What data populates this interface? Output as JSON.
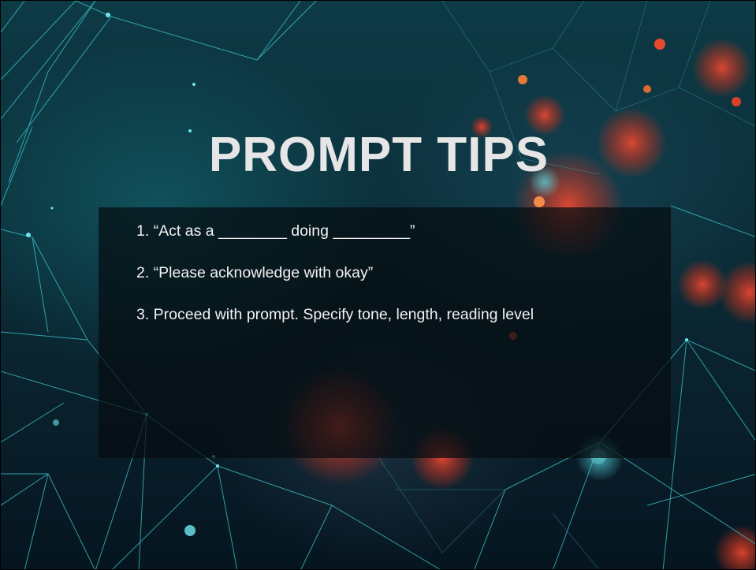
{
  "slide": {
    "title": "PROMPT TIPS",
    "tips": [
      "1. “Act as a ________ doing _________”",
      "2. “Please acknowledge with okay”",
      "3. Proceed with prompt. Specify tone, length, reading level"
    ]
  },
  "colors": {
    "background_top": "#0d3a45",
    "background_bottom": "#061520",
    "network_lines": "#3ec8d2",
    "bokeh_red": "#e0402a",
    "title_text": "#e6e6e6",
    "body_text": "#f2f2f2",
    "content_box": "rgba(5,12,16,0.72)"
  }
}
